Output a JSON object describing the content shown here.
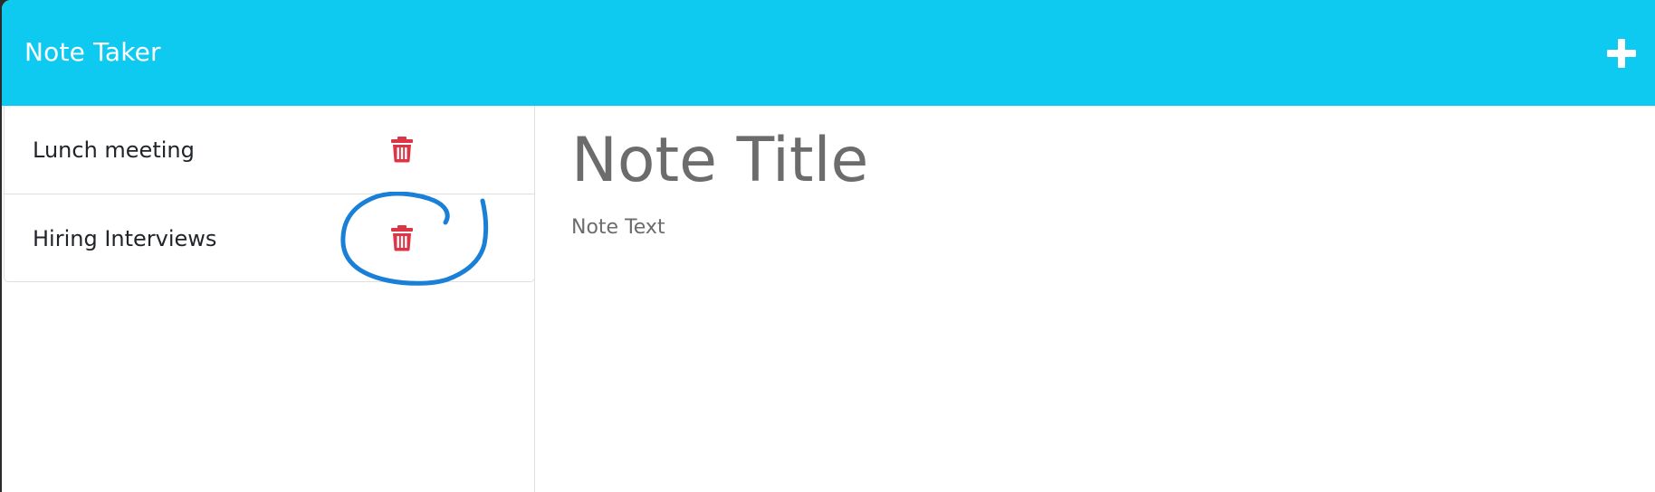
{
  "navbar": {
    "brand": "Note Taker",
    "new_note_icon": "plus-icon",
    "color": "#0fcaf0"
  },
  "notes": [
    {
      "title": "Lunch meeting",
      "delete_icon": "trash-icon"
    },
    {
      "title": "Hiring Interviews",
      "delete_icon": "trash-icon"
    }
  ],
  "editor": {
    "title_placeholder": "Note Title",
    "text_placeholder": "Note Text"
  },
  "colors": {
    "delete": "#dc3545",
    "annotation": "#1a7fd6"
  }
}
